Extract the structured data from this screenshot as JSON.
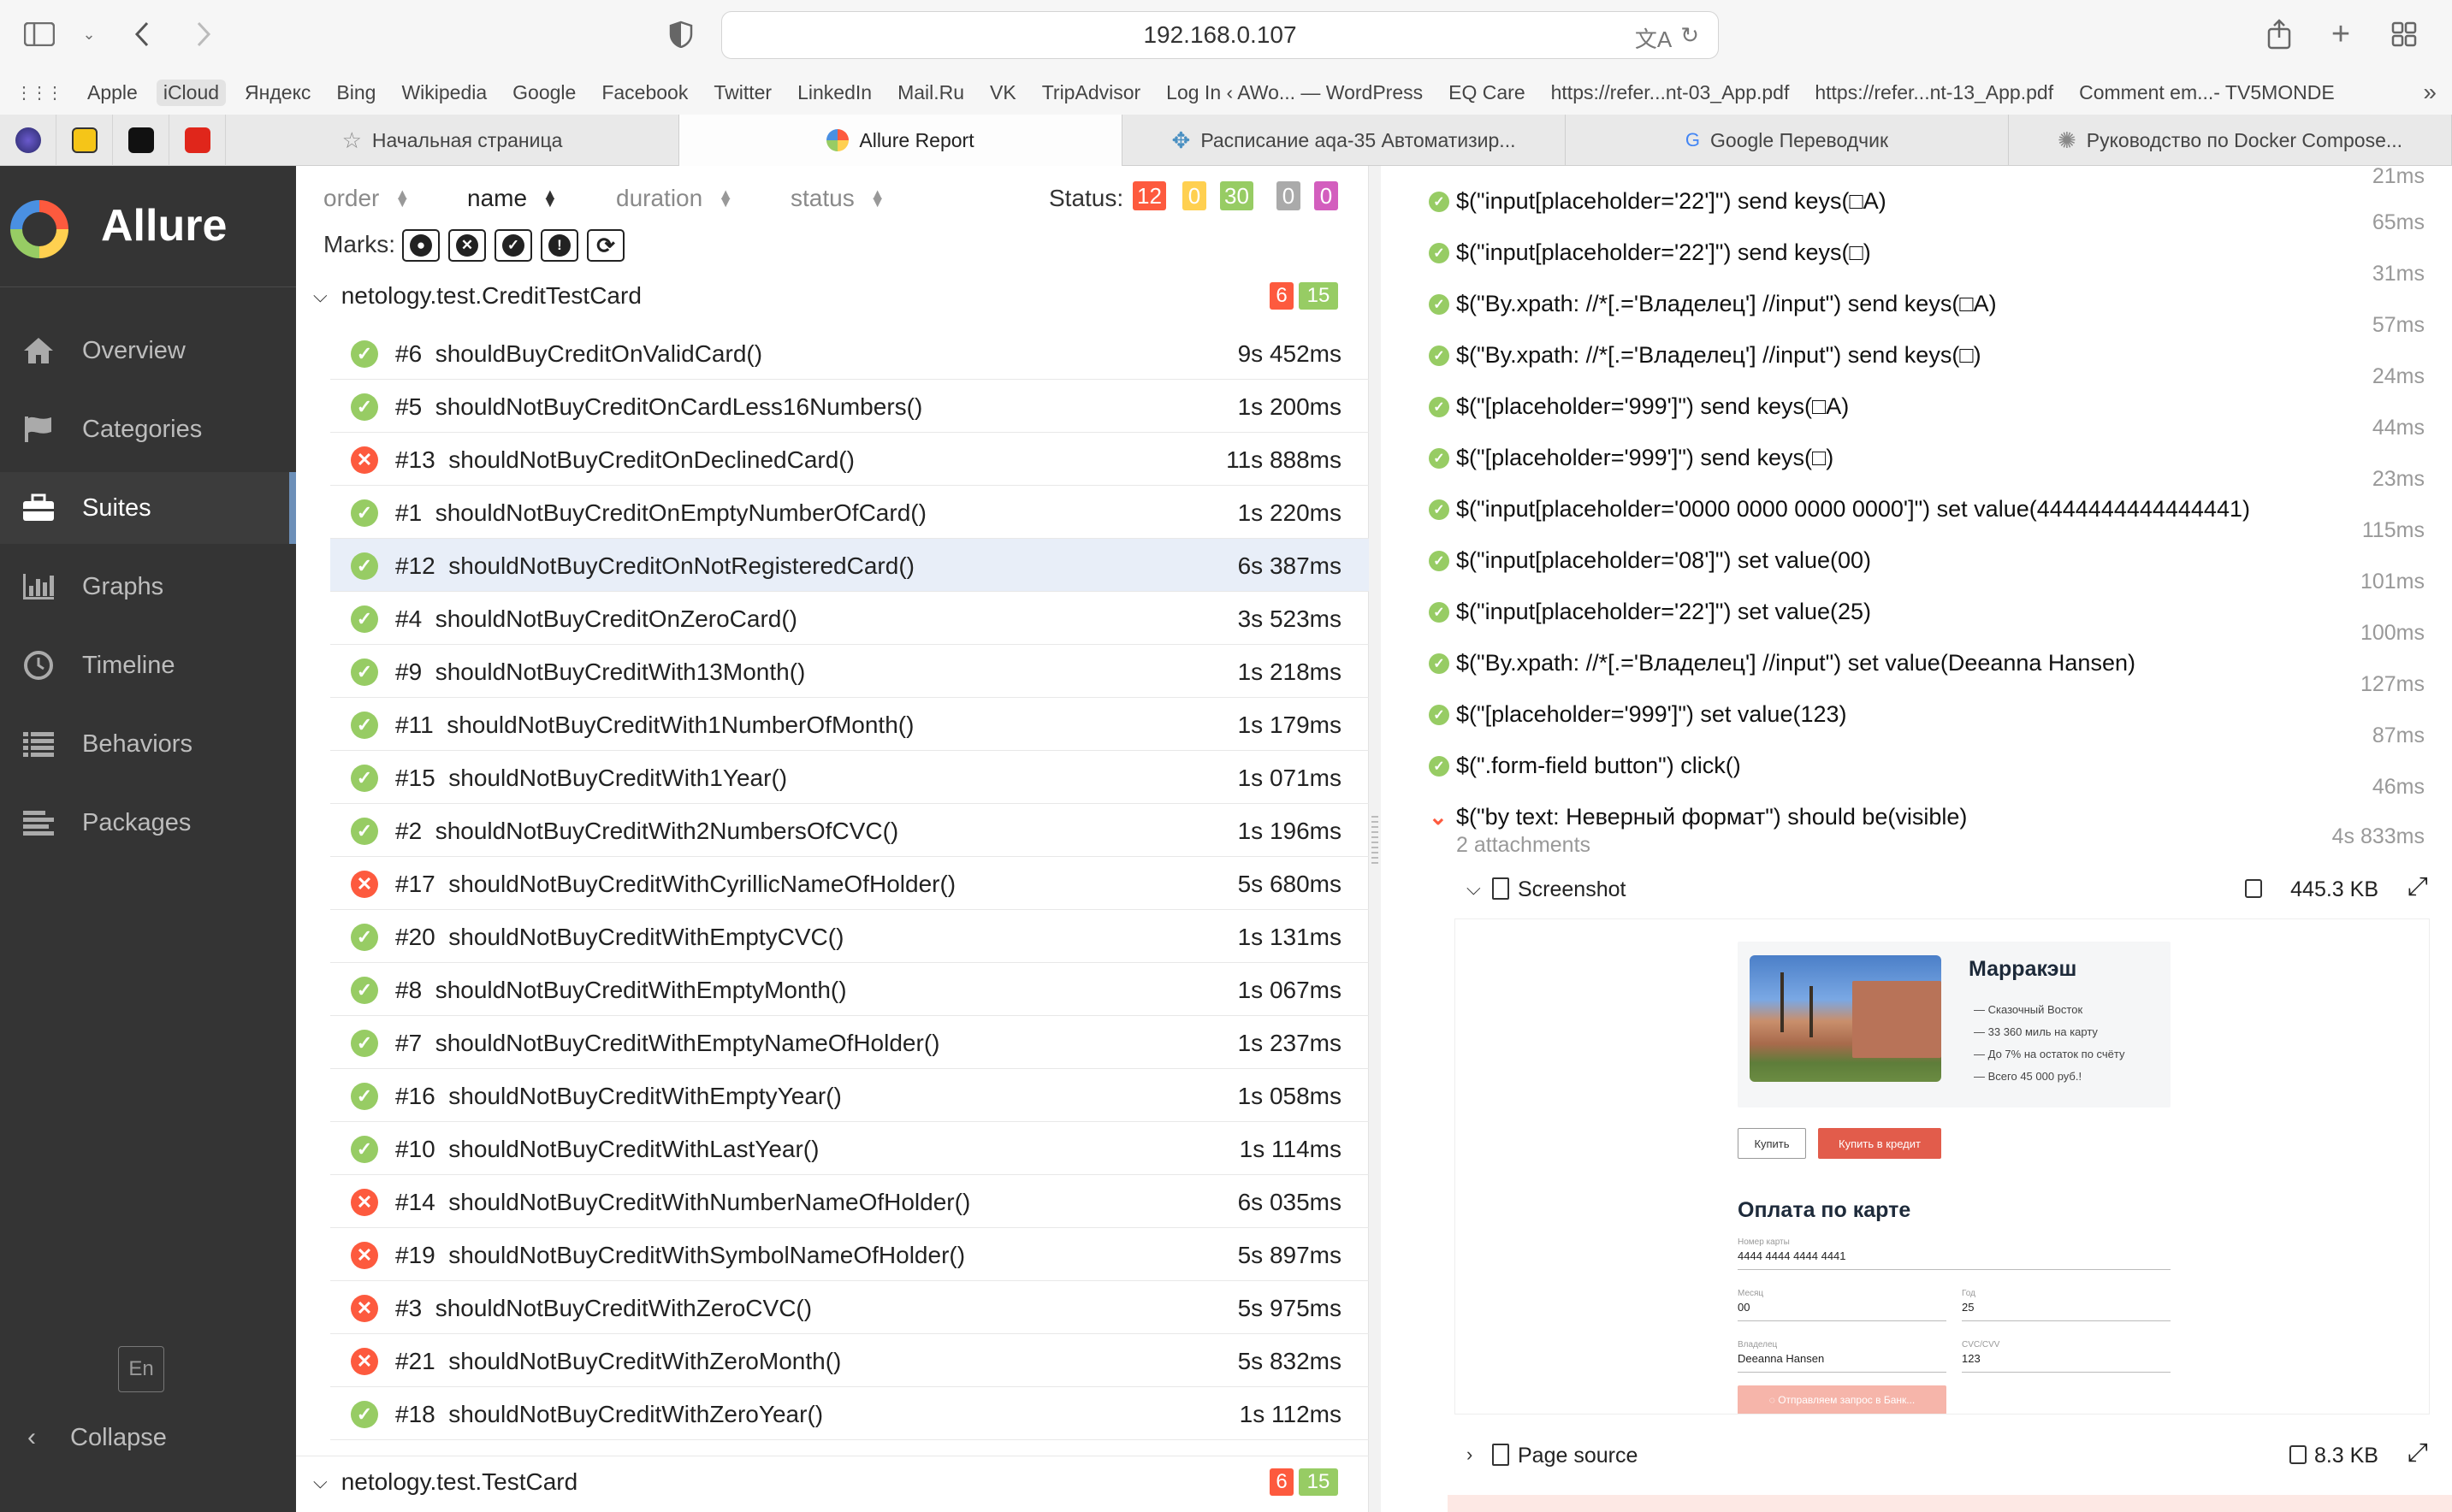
{
  "browser": {
    "address": "192.168.0.107",
    "bookmarks": [
      "Apple",
      "iCloud",
      "Яндекс",
      "Bing",
      "Wikipedia",
      "Google",
      "Facebook",
      "Twitter",
      "LinkedIn",
      "Mail.Ru",
      "VK",
      "TripAdvisor",
      "Log In ‹ AWo... — WordPress",
      "EQ Care",
      "https://refer...nt-03_App.pdf",
      "https://refer...nt-13_App.pdf",
      "Comment em...- TV5MONDE"
    ],
    "tabs": [
      {
        "label": "Начальная страница",
        "icon": "star-icon"
      },
      {
        "label": "Allure Report",
        "icon": "allure-logo-icon"
      },
      {
        "label": "Расписание aqa-35 Автоматизир...",
        "icon": "pinwheel-icon"
      },
      {
        "label": "Google Переводчик",
        "icon": "translate-icon"
      },
      {
        "label": "Руководство по Docker Compose...",
        "icon": "docker-icon"
      }
    ]
  },
  "sidebar": {
    "brand": "Allure",
    "items": [
      {
        "label": "Overview",
        "icon": "home-icon"
      },
      {
        "label": "Categories",
        "icon": "flag-icon"
      },
      {
        "label": "Suites",
        "icon": "briefcase-icon"
      },
      {
        "label": "Graphs",
        "icon": "bar-chart-icon"
      },
      {
        "label": "Timeline",
        "icon": "clock-icon"
      },
      {
        "label": "Behaviors",
        "icon": "list-icon"
      },
      {
        "label": "Packages",
        "icon": "lines-icon"
      }
    ],
    "active": "Suites",
    "lang": "En",
    "collapse": "Collapse"
  },
  "tree": {
    "sort": [
      "order",
      "name",
      "duration",
      "status"
    ],
    "status_label": "Status:",
    "status_counts": [
      {
        "value": "12",
        "color": "#fd5a3e"
      },
      {
        "value": "0",
        "color": "#ffd050"
      },
      {
        "value": "30",
        "color": "#97cc64"
      },
      {
        "value": "0",
        "color": "#aaaaaa"
      },
      {
        "value": "0",
        "color": "#d35ebe"
      }
    ],
    "marks_label": "Marks:",
    "groups": [
      {
        "name": "netology.test.CreditTestCard",
        "failed": "6",
        "passed": "15"
      },
      {
        "name": "netology.test.TestCard",
        "failed": "6",
        "passed": "15"
      }
    ],
    "rows": [
      {
        "id": "#6",
        "name": "shouldBuyCreditOnValidCard()",
        "duration": "9s 452ms",
        "status": "passed"
      },
      {
        "id": "#5",
        "name": "shouldNotBuyCreditOnCardLess16Numbers()",
        "duration": "1s 200ms",
        "status": "passed"
      },
      {
        "id": "#13",
        "name": "shouldNotBuyCreditOnDeclinedCard()",
        "duration": "11s 888ms",
        "status": "failed"
      },
      {
        "id": "#1",
        "name": "shouldNotBuyCreditOnEmptyNumberOfCard()",
        "duration": "1s 220ms",
        "status": "passed"
      },
      {
        "id": "#12",
        "name": "shouldNotBuyCreditOnNotRegisteredCard()",
        "duration": "6s 387ms",
        "status": "passed",
        "selected": true
      },
      {
        "id": "#4",
        "name": "shouldNotBuyCreditOnZeroCard()",
        "duration": "3s 523ms",
        "status": "passed"
      },
      {
        "id": "#9",
        "name": "shouldNotBuyCreditWith13Month()",
        "duration": "1s 218ms",
        "status": "passed"
      },
      {
        "id": "#11",
        "name": "shouldNotBuyCreditWith1NumberOfMonth()",
        "duration": "1s 179ms",
        "status": "passed"
      },
      {
        "id": "#15",
        "name": "shouldNotBuyCreditWith1Year()",
        "duration": "1s 071ms",
        "status": "passed"
      },
      {
        "id": "#2",
        "name": "shouldNotBuyCreditWith2NumbersOfCVC()",
        "duration": "1s 196ms",
        "status": "passed"
      },
      {
        "id": "#17",
        "name": "shouldNotBuyCreditWithCyrillicNameOfHolder()",
        "duration": "5s 680ms",
        "status": "failed"
      },
      {
        "id": "#20",
        "name": "shouldNotBuyCreditWithEmptyCVC()",
        "duration": "1s 131ms",
        "status": "passed"
      },
      {
        "id": "#8",
        "name": "shouldNotBuyCreditWithEmptyMonth()",
        "duration": "1s 067ms",
        "status": "passed"
      },
      {
        "id": "#7",
        "name": "shouldNotBuyCreditWithEmptyNameOfHolder()",
        "duration": "1s 237ms",
        "status": "passed"
      },
      {
        "id": "#16",
        "name": "shouldNotBuyCreditWithEmptyYear()",
        "duration": "1s 058ms",
        "status": "passed"
      },
      {
        "id": "#10",
        "name": "shouldNotBuyCreditWithLastYear()",
        "duration": "1s 114ms",
        "status": "passed"
      },
      {
        "id": "#14",
        "name": "shouldNotBuyCreditWithNumberNameOfHolder()",
        "duration": "6s 035ms",
        "status": "failed"
      },
      {
        "id": "#19",
        "name": "shouldNotBuyCreditWithSymbolNameOfHolder()",
        "duration": "5s 897ms",
        "status": "failed"
      },
      {
        "id": "#3",
        "name": "shouldNotBuyCreditWithZeroCVC()",
        "duration": "5s 975ms",
        "status": "failed"
      },
      {
        "id": "#21",
        "name": "shouldNotBuyCreditWithZeroMonth()",
        "duration": "5s 832ms",
        "status": "failed"
      },
      {
        "id": "#18",
        "name": "shouldNotBuyCreditWithZeroYear()",
        "duration": "1s 112ms",
        "status": "passed"
      }
    ]
  },
  "details": {
    "top_duration": "21ms",
    "steps": [
      {
        "text": "$(\"input[placeholder='22']\") send keys(□A)",
        "duration": "65ms"
      },
      {
        "text": "$(\"input[placeholder='22']\") send keys(□)",
        "duration": "31ms"
      },
      {
        "text": "$(\"By.xpath: //*[.='Владелец'] //input\") send keys(□A)",
        "duration": "57ms"
      },
      {
        "text": "$(\"By.xpath: //*[.='Владелец'] //input\") send keys(□)",
        "duration": "24ms"
      },
      {
        "text": "$(\"[placeholder='999']\") send keys(□A)",
        "duration": "44ms"
      },
      {
        "text": "$(\"[placeholder='999']\") send keys(□)",
        "duration": "23ms"
      },
      {
        "text": "$(\"input[placeholder='0000 0000 0000 0000']\") set value(4444444444444441)",
        "duration": "115ms"
      },
      {
        "text": "$(\"input[placeholder='08']\") set value(00)",
        "duration": "101ms"
      },
      {
        "text": "$(\"input[placeholder='22']\") set value(25)",
        "duration": "100ms"
      },
      {
        "text": "$(\"By.xpath: //*[.='Владелец'] //input\") set value(Deeanna Hansen)",
        "duration": "127ms"
      },
      {
        "text": "$(\"[placeholder='999']\") set value(123)",
        "duration": "87ms"
      },
      {
        "text": "$(\".form-field button\") click()",
        "duration": "46ms"
      }
    ],
    "failed_step": {
      "text": "$(\"by text: Неверный формат\") should be(visible)",
      "attachments": "2 attachments",
      "duration": "4s 833ms"
    },
    "screenshot": {
      "label": "Screenshot",
      "size": "445.3 KB"
    },
    "page_source": {
      "label": "Page source",
      "size": "8.3 KB"
    },
    "preview": {
      "city": "Марракэш",
      "features": [
        "Сказочный Восток",
        "33 360 миль на карту",
        "До 7% на остаток по счёту",
        "Всего 45 000 руб.!"
      ],
      "buy": "Купить",
      "buy_credit": "Купить в кредит",
      "form_title": "Оплата по карте",
      "card_label": "Номер карты",
      "card_value": "4444 4444 4444 4441",
      "month_label": "Месяц",
      "month_value": "00",
      "year_label": "Год",
      "year_value": "25",
      "holder_label": "Владелец",
      "holder_value": "Deeanna Hansen",
      "cvc_label": "CVC/CVV",
      "cvc_value": "123",
      "sending": "Отправляем запрос в Банк..."
    }
  }
}
